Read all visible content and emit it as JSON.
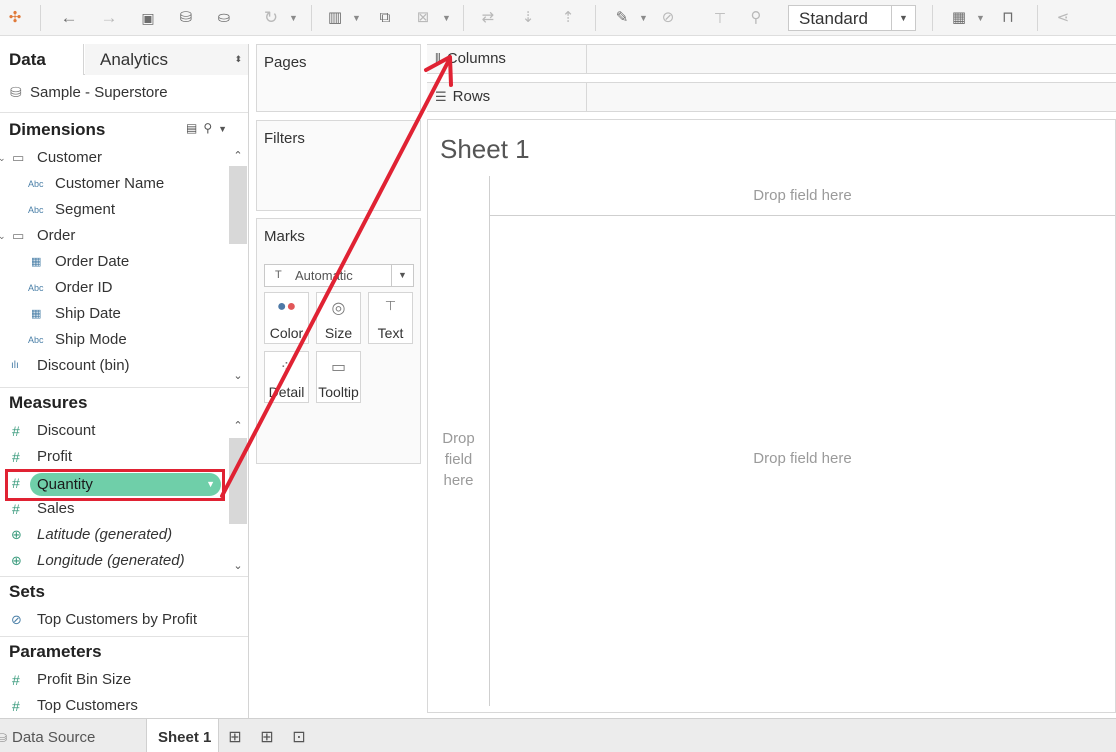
{
  "toolbar": {
    "view_select": "Standard",
    "icons": [
      "tableau-logo-icon",
      "undo-icon",
      "redo-icon",
      "save-icon",
      "new-datasource-icon",
      "pause-updates-icon",
      "refresh-icon",
      "new-worksheet-icon",
      "duplicate-sheet-icon",
      "clear-sheet-icon",
      "swap-icon",
      "sort-ascending-icon",
      "sort-descending-icon",
      "highlight-icon",
      "group-icon",
      "labels-icon",
      "fix-axes-icon",
      "show-me-chart-icon",
      "presentation-icon",
      "share-icon"
    ]
  },
  "data_pane": {
    "tab_data": "Data",
    "tab_analytics": "Analytics",
    "datasource": "Sample - Superstore",
    "dimensions_title": "Dimensions",
    "dimensions": [
      {
        "label": "Customer",
        "type": "folder"
      },
      {
        "label": "Customer Name",
        "type": "abc"
      },
      {
        "label": "Segment",
        "type": "abc"
      },
      {
        "label": "Order",
        "type": "folder"
      },
      {
        "label": "Order Date",
        "type": "date"
      },
      {
        "label": "Order ID",
        "type": "abc"
      },
      {
        "label": "Ship Date",
        "type": "date"
      },
      {
        "label": "Ship Mode",
        "type": "abc"
      },
      {
        "label": "Discount (bin)",
        "type": "bin"
      }
    ],
    "measures_title": "Measures",
    "measures": [
      {
        "label": "Discount",
        "type": "number"
      },
      {
        "label": "Profit",
        "type": "number"
      },
      {
        "label": "Quantity",
        "type": "number",
        "selected": true
      },
      {
        "label": "Sales",
        "type": "number"
      },
      {
        "label": "Latitude (generated)",
        "type": "geo"
      },
      {
        "label": "Longitude (generated)",
        "type": "geo"
      }
    ],
    "sets_title": "Sets",
    "sets": [
      {
        "label": "Top Customers by Profit"
      }
    ],
    "parameters_title": "Parameters",
    "parameters": [
      {
        "label": "Profit Bin Size"
      },
      {
        "label": "Top Customers"
      }
    ],
    "abc_badge": "Abc"
  },
  "cards": {
    "pages": "Pages",
    "filters": "Filters",
    "marks": "Marks",
    "marks_type": "Automatic",
    "mark_buttons": [
      {
        "label": "Color"
      },
      {
        "label": "Size"
      },
      {
        "label": "Text"
      },
      {
        "label": "Detail"
      },
      {
        "label": "Tooltip"
      }
    ]
  },
  "shelves": {
    "columns": "Columns",
    "rows": "Rows"
  },
  "sheet": {
    "title": "Sheet 1",
    "drop_top": "Drop field here",
    "drop_left_lines": [
      "Drop",
      "field",
      "here"
    ],
    "drop_main": "Drop field here"
  },
  "bottom_tabs": {
    "data_source": "Data Source",
    "sheet1": "Sheet 1"
  },
  "annotation": {
    "highlight_color": "#e02233",
    "pill_color": "#6fcfa9"
  }
}
